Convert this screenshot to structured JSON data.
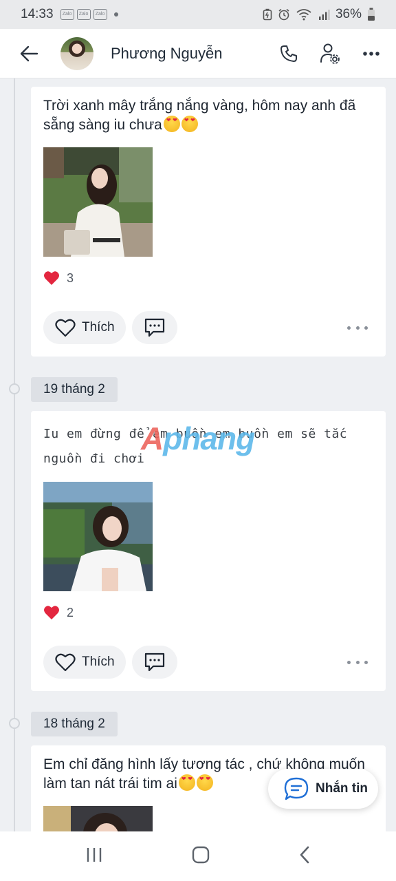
{
  "status_bar": {
    "time": "14:33",
    "zalo_badges": [
      "Zalo",
      "Zalo",
      "Zalo"
    ],
    "battery": "36%",
    "icons": [
      "battery-saver-icon",
      "alarm-icon",
      "wifi-icon",
      "signal-icon",
      "battery-icon"
    ]
  },
  "header": {
    "contact_name": "Phương Nguyễn",
    "icons": [
      "back-arrow-icon",
      "phone-icon",
      "user-settings-icon",
      "more-icon"
    ]
  },
  "posts": [
    {
      "text": "Trời xanh mây trắng nắng vàng, hôm nay anh đã sẵng sàng iu chưa",
      "emojis": "😍😍",
      "reaction_count": "3",
      "like_label": "Thích"
    },
    {
      "date": "19 tháng 2",
      "text": "Iu em đừng để em buồn em buồn em sẽ tắc nguồn đi chơi",
      "reaction_count": "2",
      "like_label": "Thích"
    },
    {
      "date": "18 tháng 2",
      "text": "Em chỉ đăng hình lấy tương tác , chứ không muốn làm tan nát trái tim ai",
      "emojis": "😍😍"
    }
  ],
  "watermark": {
    "first": "A",
    "rest": "phang"
  },
  "message_button": {
    "label": "Nhắn tin"
  },
  "colors": {
    "accent": "#1f6fd6",
    "heart": "#e3263f",
    "background": "#eef0f3"
  }
}
